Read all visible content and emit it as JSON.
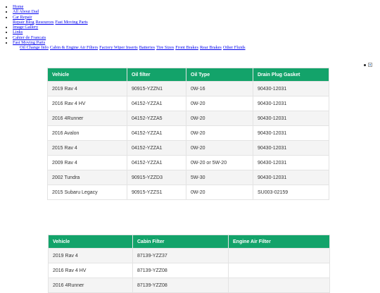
{
  "nav": {
    "home": "Home",
    "about": "All About Dad",
    "car_repair": "Car Repair",
    "car_repair_sub": [
      "Repair Blog",
      "Resources",
      "Fast Moving Parts"
    ],
    "gallery": "Image Gallery",
    "links": "Links",
    "cahier": "Cahier de Francais",
    "fast_moving": "Fast Moving Parts",
    "fast_moving_sub": [
      "Oil Change Info",
      "Cabin & Engine Air Filters",
      "Factory Wiper Inserts",
      "Batteries",
      "Tire Sizes",
      "Front Brakes",
      "Rear Brakes",
      "Other Fluids"
    ]
  },
  "oil_table": {
    "headers": [
      "Vehicle",
      "Oil filter",
      "Oil Type",
      "Drain Plug Gasket"
    ],
    "rows": [
      [
        "2019 Rav 4",
        "90915-YZZN1",
        "0W-16",
        "90430-12031"
      ],
      [
        "2016 Rav 4 HV",
        "04152-YZZA1",
        "0W-20",
        "90430-12031"
      ],
      [
        "2016 4Runner",
        "04152-YZZA5",
        "0W-20",
        "90430-12031"
      ],
      [
        "2016 Avalon",
        "04152-YZZA1",
        "0W-20",
        "90430-12031"
      ],
      [
        "2015 Rav 4",
        "04152-YZZA1",
        "0W-20",
        "90430-12031"
      ],
      [
        "2009 Rav 4",
        "04152-YZZA1",
        "0W-20 or 5W-20",
        "90430-12031"
      ],
      [
        "2002 Tundra",
        "90915-YZZD3",
        "5W-30",
        "90430-12031"
      ],
      [
        "2015 Subaru Legacy",
        "90915-YZZS1",
        "0W-20",
        "SU003-02159"
      ]
    ]
  },
  "filter_table": {
    "headers": [
      "Vehicle",
      "Cabin Filter",
      "Engine Air Filter"
    ],
    "rows": [
      [
        "2019 Rav 4",
        "87139-YZZ37",
        ""
      ],
      [
        "2016 Rav 4 HV",
        "87139-YZZ08",
        ""
      ],
      [
        "2016 4Runner",
        "87139-YZZ08",
        ""
      ]
    ]
  }
}
